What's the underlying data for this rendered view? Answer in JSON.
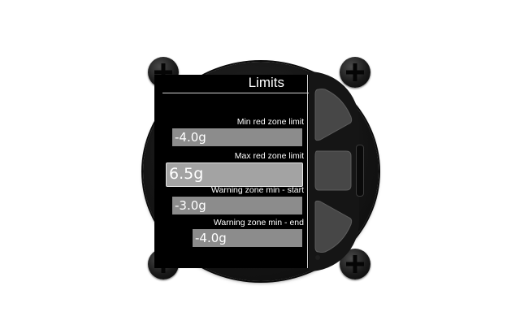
{
  "screen": {
    "title": "Limits",
    "fields": [
      {
        "label": "Min red zone limit",
        "value": "-4.0g",
        "selected": false
      },
      {
        "label": "Max red zone limit",
        "value": "6.5g",
        "selected": true
      },
      {
        "label": "Warning zone min - start",
        "value": "-3.0g",
        "selected": false
      },
      {
        "label": "Warning zone min - end",
        "value": "-4.0g",
        "selected": false
      }
    ]
  },
  "colors": {
    "screen_bg": "#000000",
    "field_bg": "#8c8c8c",
    "field_selected_bg": "#a3a3a3",
    "text": "#ffffff"
  },
  "icons": [
    "screw-icon",
    "screw-icon",
    "screw-icon",
    "screw-icon"
  ]
}
